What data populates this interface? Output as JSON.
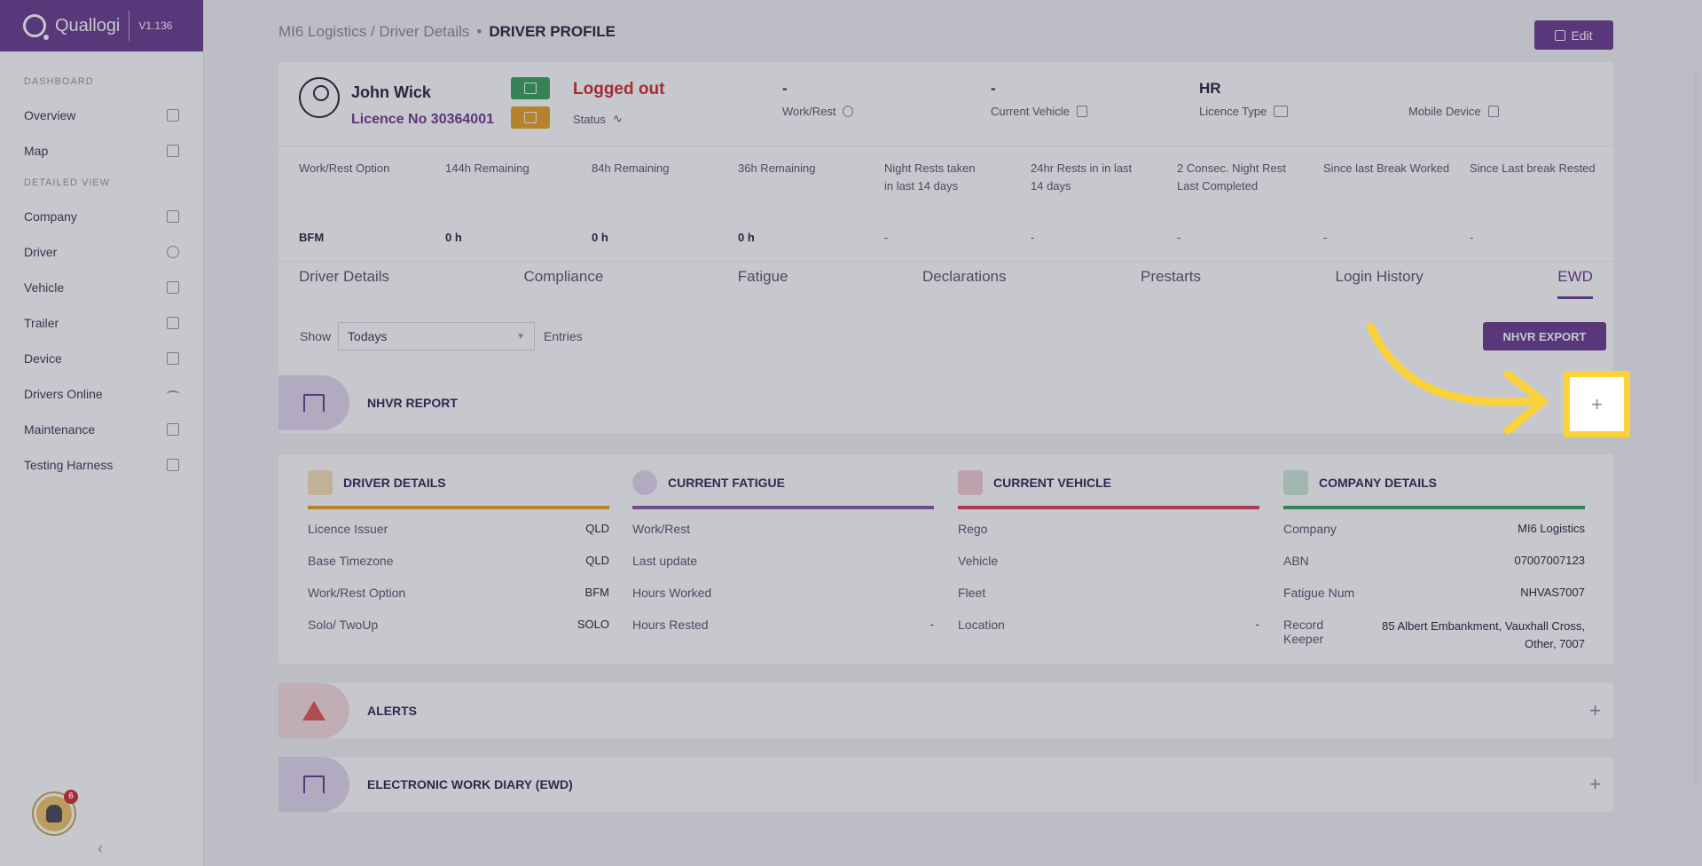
{
  "brand": {
    "name": "Quallogi",
    "version": "V1.136"
  },
  "sidebar": {
    "section_dashboard": "DASHBOARD",
    "section_detailed": "DETAILED VIEW",
    "dashboard_items": [
      {
        "label": "Overview",
        "icon": "grid-icon"
      },
      {
        "label": "Map",
        "icon": "map-icon"
      }
    ],
    "detailed_items": [
      {
        "label": "Company",
        "icon": "building-icon"
      },
      {
        "label": "Driver",
        "icon": "user-icon"
      },
      {
        "label": "Vehicle",
        "icon": "truck-icon"
      },
      {
        "label": "Trailer",
        "icon": "trailer-icon"
      },
      {
        "label": "Device",
        "icon": "phone-icon"
      },
      {
        "label": "Drivers Online",
        "icon": "wifi-icon"
      },
      {
        "label": "Maintenance",
        "icon": "wrench-icon"
      },
      {
        "label": "Testing Harness",
        "icon": "monitor-icon"
      }
    ],
    "notification_count": "6",
    "collapse_label": "‹"
  },
  "header": {
    "breadcrumb_parent": "MI6 Logistics / Driver Details",
    "breadcrumb_sep": "•",
    "breadcrumb_current": "DRIVER PROFILE",
    "edit_label": "Edit"
  },
  "profile": {
    "name": "John Wick",
    "licence": "Licence No 30364001",
    "status_value": "Logged out",
    "status_label": "Status",
    "work_rest_value": "-",
    "work_rest_label": "Work/Rest",
    "vehicle_value": "-",
    "vehicle_label": "Current Vehicle",
    "licence_type_value": "HR",
    "licence_type_label": "Licence Type",
    "mobile_label": "Mobile Device"
  },
  "work_rest_table": {
    "headers": [
      "Work/Rest Option",
      "144h Remaining",
      "84h Remaining",
      "36h Remaining",
      "Night Rests taken in last 14 days",
      "24hr Rests in in last 14 days",
      "2 Consec. Night Rest Last Completed",
      "Since last Break Worked",
      "Since Last break Rested"
    ],
    "values": [
      "BFM",
      "0 h",
      "0 h",
      "0 h",
      "-",
      "-",
      "-",
      "-",
      "-"
    ]
  },
  "tabs": [
    "Driver Details",
    "Compliance",
    "Fatigue",
    "Declarations",
    "Prestarts",
    "Login History",
    "EWD"
  ],
  "active_tab": "EWD",
  "filter": {
    "show_label": "Show",
    "selected": "Todays",
    "entries_label": "Entries",
    "export_label": "NHVR EXPORT"
  },
  "sections": {
    "nhvr_report": "NHVR REPORT",
    "alerts": "ALERTS",
    "ewd": "ELECTRONIC WORK DIARY (EWD)",
    "expand_symbol": "+"
  },
  "details": {
    "driver": {
      "title": "DRIVER DETAILS",
      "color": "#e8a32a",
      "rows": [
        {
          "label": "Licence Issuer",
          "value": "QLD"
        },
        {
          "label": "Base Timezone",
          "value": "QLD"
        },
        {
          "label": "Work/Rest Option",
          "value": "BFM"
        },
        {
          "label": "Solo/ TwoUp",
          "value": "SOLO"
        }
      ]
    },
    "fatigue": {
      "title": "CURRENT FATIGUE",
      "color": "#8e5aa8",
      "rows": [
        {
          "label": "Work/Rest",
          "value": ""
        },
        {
          "label": "Last update",
          "value": ""
        },
        {
          "label": "Hours Worked",
          "value": ""
        },
        {
          "label": "Hours Rested",
          "value": "-"
        }
      ]
    },
    "vehicle": {
      "title": "CURRENT VEHICLE",
      "color": "#d9475e",
      "rows": [
        {
          "label": "Rego",
          "value": ""
        },
        {
          "label": "Vehicle",
          "value": ""
        },
        {
          "label": "Fleet",
          "value": ""
        },
        {
          "label": "Location",
          "value": "-"
        }
      ]
    },
    "company": {
      "title": "COMPANY DETAILS",
      "color": "#3ca55c",
      "rows": [
        {
          "label": "Company",
          "value": "MI6 Logistics"
        },
        {
          "label": "ABN",
          "value": "07007007123"
        },
        {
          "label": "Fatigue Num",
          "value": "NHVAS7007"
        },
        {
          "label": "Record Keeper",
          "value": "85 Albert Embankment, Vauxhall Cross, Other, 7007"
        }
      ]
    }
  },
  "colors": {
    "brand": "#6b3f8f",
    "highlight": "#fbd23a",
    "logged_out": "#d32f2f"
  }
}
